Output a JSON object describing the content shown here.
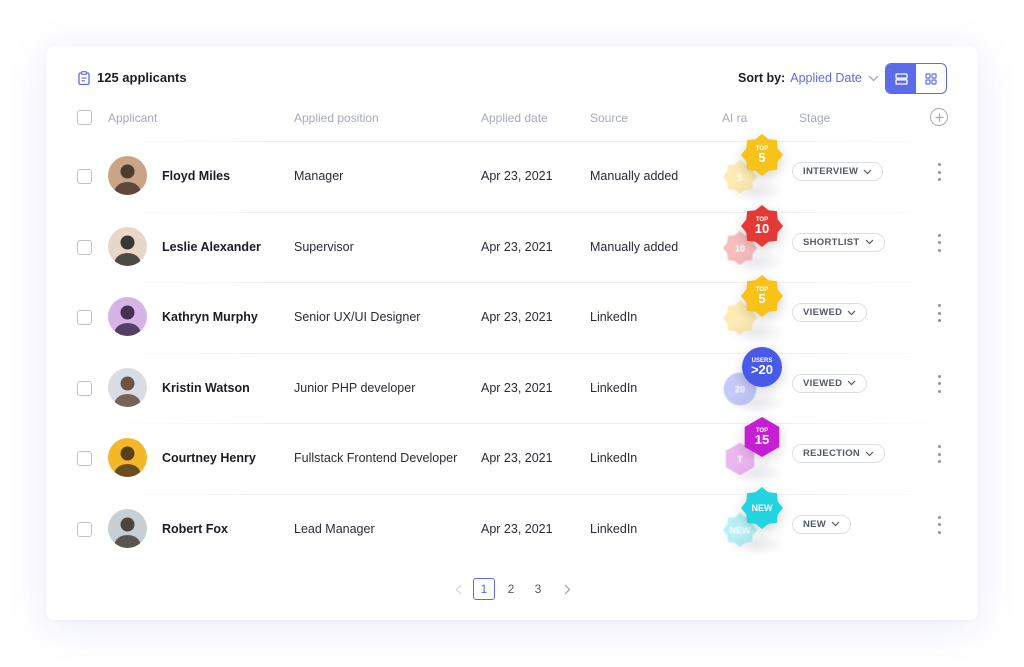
{
  "header": {
    "applicant_count": "125 applicants",
    "sort_label": "Sort by:",
    "sort_value": "Applied Date"
  },
  "columns": {
    "applicant": "Applicant",
    "position": "Applied position",
    "date": "Applied date",
    "source": "Source",
    "ai_rank": "AI ra",
    "stage": "Stage"
  },
  "rows": [
    {
      "name": "Floyd Miles",
      "position": "Manager",
      "date": "Apr 23, 2021",
      "source": "Manually added",
      "stage": "INTERVIEW",
      "badge_top": "TOP",
      "badge_value": "5",
      "badge_color": "#f7c21a",
      "ghost_value": "5"
    },
    {
      "name": "Leslie Alexander",
      "position": "Supervisor",
      "date": "Apr 23, 2021",
      "source": "Manually added",
      "stage": "SHORTLIST",
      "badge_top": "TOP",
      "badge_value": "10",
      "badge_color": "#e53935",
      "ghost_value": "10"
    },
    {
      "name": "Kathryn Murphy",
      "position": "Senior UX/UI Designer",
      "date": "Apr 23, 2021",
      "source": "LinkedIn",
      "stage": "VIEWED",
      "badge_top": "TOP",
      "badge_value": "5",
      "badge_color": "#f7c21a",
      "ghost_value": ""
    },
    {
      "name": "Kristin Watson",
      "position": "Junior PHP developer",
      "date": "Apr 23, 2021",
      "source": "LinkedIn",
      "stage": "VIEWED",
      "badge_top": "USERS",
      "badge_value": ">20",
      "badge_color": "#4a5ae8",
      "ghost_value": "20"
    },
    {
      "name": "Courtney Henry",
      "position": "Fullstack Frontend Developer",
      "date": "Apr 23, 2021",
      "source": "LinkedIn",
      "stage": "REJECTION",
      "badge_top": "TOP",
      "badge_value": "15",
      "badge_color": "#c51fd4",
      "ghost_value": "T"
    },
    {
      "name": "Robert Fox",
      "position": "Lead Manager",
      "date": "Apr 23, 2021",
      "source": "LinkedIn",
      "stage": "NEW",
      "badge_top": "",
      "badge_value": "NEW",
      "badge_color": "#22d3e0",
      "ghost_value": "NEW"
    }
  ],
  "pagination": {
    "pages": [
      "1",
      "2",
      "3"
    ],
    "current": "1"
  },
  "colors": {
    "accent": "#5c6ce8"
  }
}
